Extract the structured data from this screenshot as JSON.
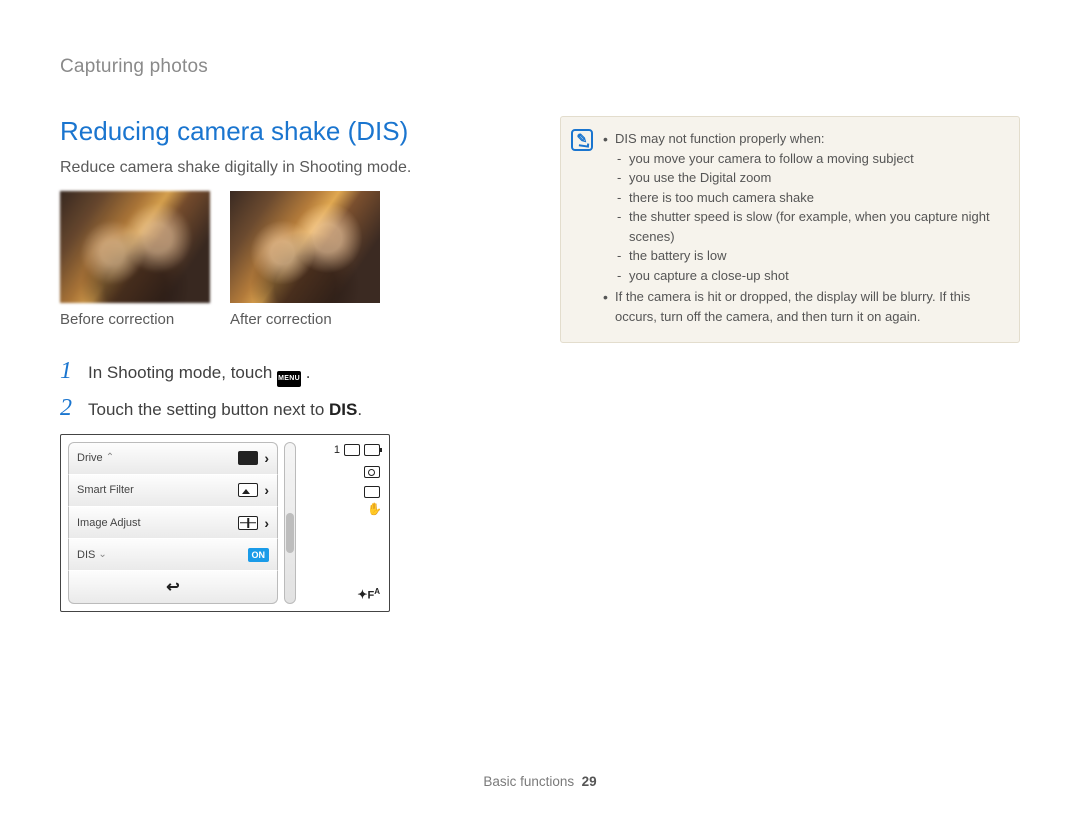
{
  "breadcrumb": "Capturing photos",
  "heading": "Reducing camera shake (DIS)",
  "intro": "Reduce camera shake digitally in Shooting mode.",
  "photos": {
    "before_caption": "Before correction",
    "after_caption": "After correction"
  },
  "steps": [
    {
      "num": "1",
      "text_before": "In Shooting mode, touch ",
      "chip": "MENU",
      "text_after": " ."
    },
    {
      "num": "2",
      "text_before": "Touch the setting button next to ",
      "bold": "DIS",
      "text_after": "."
    }
  ],
  "lcd": {
    "rows": [
      {
        "label": "Drive",
        "value_icon": "filled",
        "arrow": true,
        "caret": "up"
      },
      {
        "label": "Smart Filter",
        "value_icon": "img",
        "arrow": true
      },
      {
        "label": "Image Adjust",
        "value_icon": "grid",
        "arrow": true
      },
      {
        "label": "DIS",
        "value_badge": "ON",
        "caret": "down"
      }
    ],
    "status": {
      "count": "1",
      "flash_label": "F",
      "flash_sup": "A"
    }
  },
  "note": {
    "lead": "DIS may not function properly when:",
    "items": [
      "you move your camera to follow a moving subject",
      "you use the Digital zoom",
      "there is too much camera shake",
      "the shutter speed is slow (for example, when you capture night scenes)",
      "the battery is low",
      "you capture a close-up shot"
    ],
    "extra": "If the camera is hit or dropped, the display will be blurry. If this occurs, turn off the camera, and then turn it on again."
  },
  "footer": {
    "section": "Basic functions",
    "page": "29"
  }
}
